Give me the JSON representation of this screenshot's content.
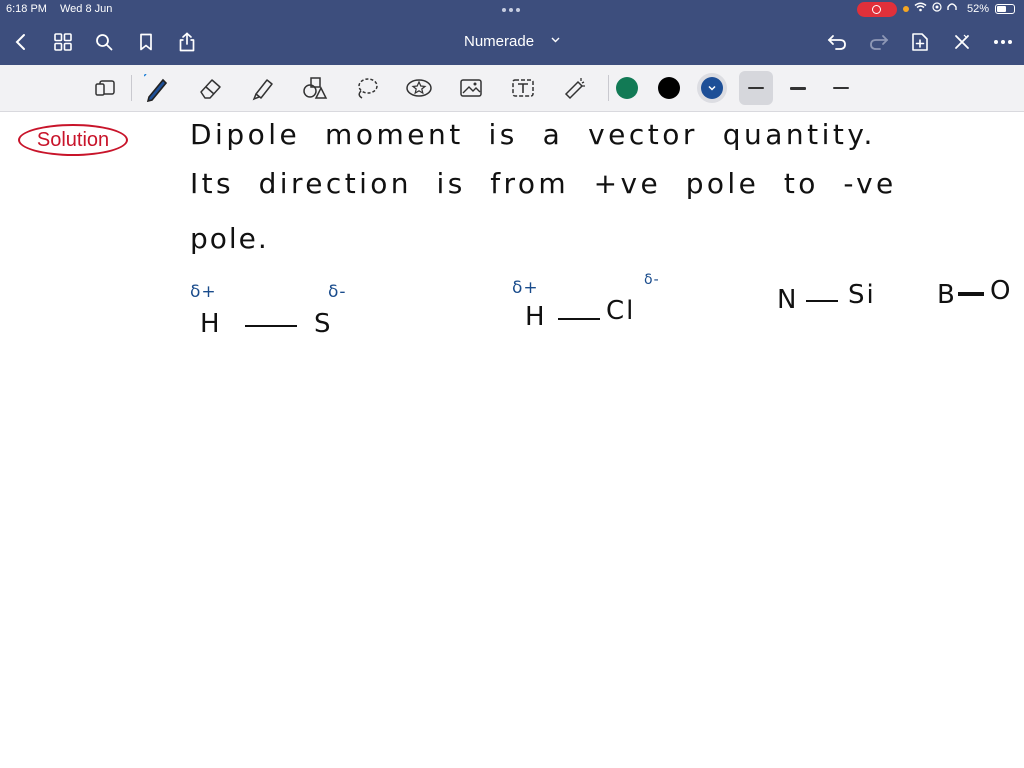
{
  "status_bar": {
    "time": "6:18 PM",
    "date": "Wed 8 Jun",
    "battery": "52%"
  },
  "nav": {
    "title": "Numerade"
  },
  "toolbar": {
    "tools": [
      "layout-icon",
      "pen-icon",
      "eraser-icon",
      "highlighter-icon",
      "shapes-icon",
      "lasso-icon",
      "sticker-icon",
      "image-icon",
      "text-icon",
      "laser-icon"
    ],
    "colors": [
      "#127a55",
      "#000000",
      "#1d4f97"
    ],
    "selected_color": "#1d4f97"
  },
  "note": {
    "badge": "Solution",
    "line1": "Dipole  moment  is  a  vector  quantity.",
    "line2": "Its  direction  is  from  +ve  pole  to  -ve",
    "line3": "pole.",
    "molecules": [
      {
        "left": "H",
        "right": "S",
        "left_charge": "δ+",
        "right_charge": "δ-"
      },
      {
        "left": "H",
        "right": "Cl",
        "left_charge": "δ+",
        "right_charge": "δ-"
      },
      {
        "left": "N",
        "right": "Si"
      },
      {
        "left": "B",
        "right": "O"
      }
    ]
  }
}
